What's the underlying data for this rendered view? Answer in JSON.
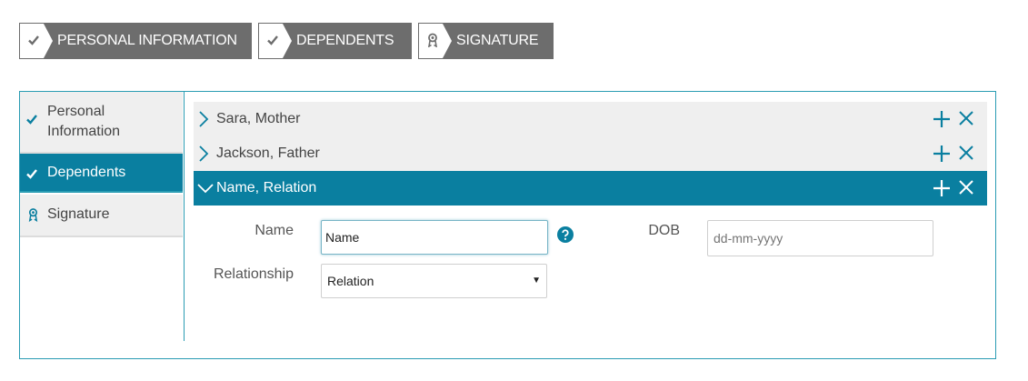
{
  "wizard": {
    "steps": [
      {
        "label": "PERSONAL INFORMATION",
        "icon": "check-icon"
      },
      {
        "label": "DEPENDENTS",
        "icon": "check-icon"
      },
      {
        "label": "SIGNATURE",
        "icon": "award-icon"
      }
    ]
  },
  "sidebar": {
    "items": [
      {
        "label_line1": "Personal",
        "label_line2": "Information",
        "icon": "check-icon",
        "active": false
      },
      {
        "label": "Dependents",
        "icon": "check-icon",
        "active": true
      },
      {
        "label": "Signature",
        "icon": "award-icon",
        "active": false
      }
    ]
  },
  "dependents": {
    "items": [
      {
        "title": "Sara, Mother",
        "expanded": false
      },
      {
        "title": "Jackson, Father",
        "expanded": false
      },
      {
        "title": "Name, Relation",
        "expanded": true
      }
    ]
  },
  "form": {
    "name_label": "Name",
    "name_value": "Name",
    "dob_label": "DOB",
    "dob_placeholder": "dd-mm-yyyy",
    "relationship_label": "Relationship",
    "relationship_value": "Relation",
    "select_arrow": "▼"
  },
  "colors": {
    "accent": "#0a7fa0",
    "border": "#2a9cb3",
    "step_bg": "#6d6d6d",
    "inactive_bg": "#efefef"
  }
}
